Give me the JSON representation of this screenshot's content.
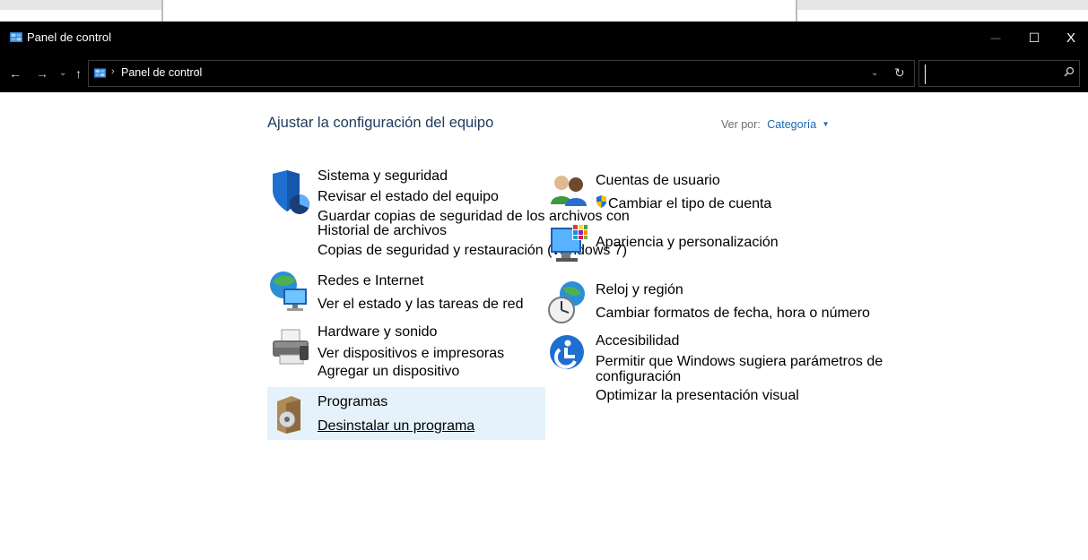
{
  "window": {
    "title": "Panel de control",
    "min_glyph": "—",
    "max_glyph": "☐",
    "close_glyph": "X"
  },
  "nav": {
    "back_glyph": "←",
    "forward_glyph": "→",
    "recent_glyph": "⌄",
    "up_glyph": "↑",
    "dropdown_glyph": "⌄",
    "refresh_glyph": "↻"
  },
  "address": {
    "crumb_sep": "›",
    "crumb": "Panel de control",
    "crumb_trailing_sep": "›"
  },
  "search": {
    "placeholder": "",
    "value": ""
  },
  "content": {
    "heading": "Ajustar la configuración del equipo",
    "view_by_label": "Ver por:",
    "view_by_value": "Categoría",
    "view_by_caret": "▼"
  },
  "left_categories": [
    {
      "title": "Sistema y seguridad",
      "links": [
        "Revisar el estado del equipo",
        "Guardar copias de seguridad de los archivos con",
        "Historial de archivos",
        "Copias de seguridad y restauración (Windows 7)"
      ]
    },
    {
      "title": "Redes e Internet",
      "links": [
        "Ver el estado y las tareas de red"
      ]
    },
    {
      "title": "Hardware y sonido",
      "links": [
        "Ver dispositivos e impresoras",
        "Agregar un dispositivo"
      ]
    },
    {
      "title": "Programas",
      "links": [
        "Desinstalar un programa"
      ]
    }
  ],
  "right_categories": [
    {
      "title": "Cuentas de usuario",
      "links": [
        "Cambiar el tipo de cuenta"
      ]
    },
    {
      "title": "Apariencia y personalización",
      "links": []
    },
    {
      "title": "Reloj y región",
      "links": [
        "Cambiar formatos de fecha, hora o número"
      ]
    },
    {
      "title": "Accesibilidad",
      "links": [
        "Permitir que Windows sugiera parámetros de",
        "configuración",
        "Optimizar la presentación visual"
      ]
    }
  ],
  "colors": {
    "title_bar": "#000000",
    "heading": "#1e395b",
    "category_title": "#0e7a13",
    "link": "#1a65b8",
    "hover_bg": "#e5f2fb"
  }
}
